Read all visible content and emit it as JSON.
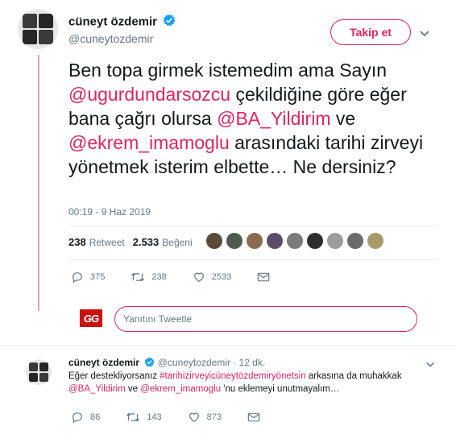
{
  "tweet": {
    "author_name": "cüneyt özdemir",
    "author_handle": "@cuneytozdemir",
    "follow_label": "Takip et",
    "text_parts": {
      "t1": "Ben topa girmek istemedim ama Sayın",
      "m1": "@ugurdundarsozcu",
      "t2": " çekildiğine göre eğer bana çağrı olursa ",
      "m2": "@BA_Yildirim",
      "t3": " ve",
      "m3": "@ekrem_imamoglu",
      "t4": " arasındaki tarihi zirveyi yönetmek isterim elbette… Ne dersiniz?"
    },
    "timestamp": "00:19 - 9 Haz 2019",
    "retweet_count": "238",
    "retweet_label": "Retweet",
    "like_count": "2.533",
    "like_label": "Beğeni",
    "actions": {
      "replies": "375",
      "retweets": "238",
      "likes": "2533"
    }
  },
  "reply_box": {
    "logo": "GG",
    "placeholder": "Yanıtını Tweetle"
  },
  "reply_tweet": {
    "author_name": "cüneyt özdemir",
    "author_handle": "@cuneytozdemir",
    "time_ago": "· 12 dk.",
    "text_parts": {
      "t1": "Eğer destekliyorsanız ",
      "h1": "#tarihizirveyicüneytözdemiryönetsin",
      "t2": " arkasına da muhakkak",
      "m1": "@BA_Yildirim",
      "t3": " ve ",
      "m2": "@ekrem_imamoglu",
      "t4": " 'nu eklemeyi unutmayalım…"
    },
    "actions": {
      "replies": "86",
      "retweets": "143",
      "likes": "873"
    }
  },
  "colors": {
    "accent": "#e0245e",
    "verified": "#1da1f2",
    "thread_line": "#e3a1c6"
  }
}
